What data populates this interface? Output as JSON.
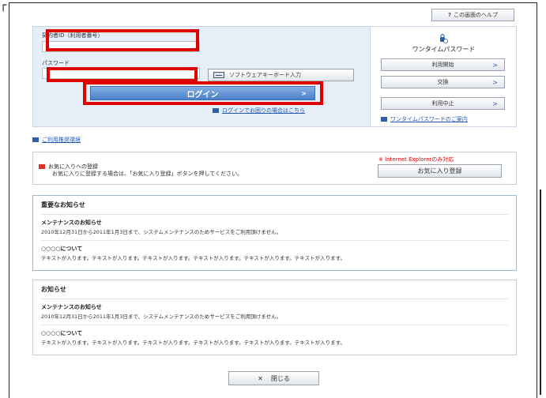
{
  "help": {
    "icon": "question-icon",
    "label": "この画面のヘルプ"
  },
  "login": {
    "id_label": "契約者ID（利用者番号）",
    "password_label": "パスワード",
    "id_value": "",
    "password_value": "",
    "software_keyboard_label": "ソフトウェアキーボード入力",
    "login_button_label": "ログイン",
    "trouble_link": "ログインでお困りの場合はこちら"
  },
  "otp": {
    "title": "ワンタイムパスワード",
    "buttons": [
      "利用開始",
      "交換",
      "利用中止"
    ],
    "info_link": "ワンタイムパスワードのご案内"
  },
  "environment_link": "ご利用推奨環境",
  "favorites": {
    "title": "お気に入りへの登録",
    "description": "お気に入りに登録する場合は、「お気に入り登録」ボタンを押してください。",
    "note": "※ Internet Explorerのみ対応",
    "button_label": "お気に入り登録"
  },
  "important": {
    "heading": "重要なお知らせ",
    "items": [
      {
        "title": "メンテナンスのお知らせ",
        "body": "2010年12月31日から2011年1月3日まで、システムメンテナンスのためサービスをご利用頂けません。"
      },
      {
        "title": "○○○○について",
        "body": "テキストが入ります。テキストが入ります。テキストが入ります。テキストが入ります。テキストが入ります。テキストが入ります。"
      }
    ]
  },
  "notices": {
    "heading": "お知らせ",
    "items": [
      {
        "title": "メンテナンスのお知らせ",
        "body": "2010年12月31日から2011年1月3日まで、システムメンテナンスのためサービスをご利用頂けません。"
      },
      {
        "title": "○○○○について",
        "body": "テキストが入ります。テキストが入ります。テキストが入ります。テキストが入ります。テキストが入ります。テキストが入ります。"
      }
    ]
  },
  "close_button": {
    "icon": "close-icon",
    "label": "閉じる"
  },
  "colors": {
    "highlight": "#e00000",
    "accent": "#4a80c8",
    "panel": "#e6eef8"
  }
}
